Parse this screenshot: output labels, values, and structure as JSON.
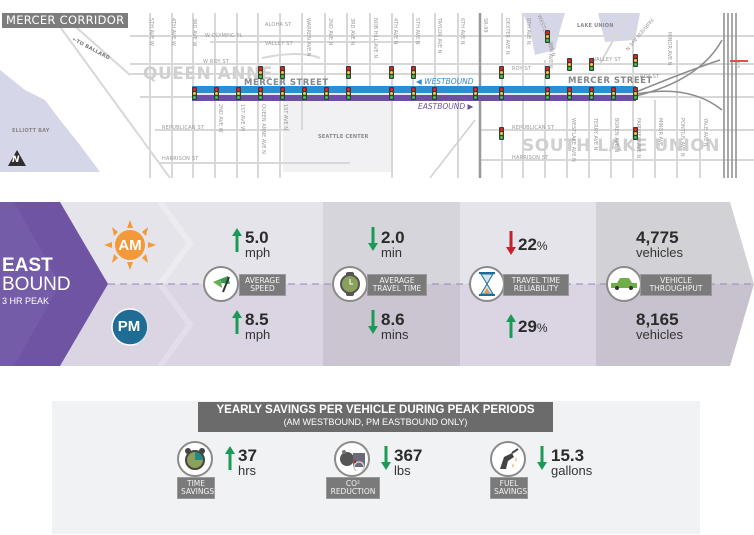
{
  "map": {
    "title": "MERCER CORRIDOR",
    "neighborhoods": [
      "QUEEN ANNE",
      "SOUTH LAKE UNION"
    ],
    "landmarks": {
      "elliott_bay": "ELLIOTT BAY",
      "seattle_center": "SEATTLE CENTER",
      "lake_union": "LAKE UNION",
      "to_ballard": "←TO BALLARD"
    },
    "corridor_label": "MERCER STREET",
    "corridor_label_east": "MERCER STREET",
    "westbound_label": "◀ WESTBOUND",
    "eastbound_label": "EASTBOUND ▶",
    "north_icon": "N",
    "streets_horizontal": [
      "ALOHA ST",
      "W OLYMPIC PL",
      "VALLEY ST",
      "W ROY ST",
      "REPUBLICAN ST",
      "HARRISON ST",
      "ROY ST",
      "REPUBLICAN ST",
      "HARRISON ST",
      "VALLEY ST",
      "ROY ST"
    ],
    "streets_vertical": [
      "5TH AVE W",
      "4TH AVE W",
      "3RD AVE W",
      "WARREN AVE N",
      "2ND AVE N",
      "3RD AVE N",
      "NOB HILL AVE N",
      "4TH AVE N",
      "5TH AVE N",
      "TAYLOR AVE N",
      "6TH AVE N",
      "SR-99",
      "DEXTER AVE N",
      "8TH AVE N",
      "9TH AVE N",
      "WESTLAKE AVE N",
      "FAIRVIEW AVE N",
      "MINOR AVE N",
      "2ND AVE W",
      "1ST AVE W",
      "QUEEN ANNE AVE N",
      "1ST AVE N",
      "WESTLAKE AVE N",
      "TERRY AVE N",
      "BOREN AVE N",
      "FAIRVIEW AVE N",
      "MINOR AVE",
      "PONTIUS AVE N",
      "YALE AVE N",
      "I-5"
    ],
    "colors": {
      "westbound": "#2a8fd0",
      "eastbound": "#6d4fa0",
      "water": "#d5d5e8"
    }
  },
  "eastbound": {
    "title_line1": "EAST",
    "title_line2": "BOUND",
    "subtitle": "3 HR PEAK",
    "am_label": "AM",
    "pm_label": "PM",
    "metrics": [
      {
        "name": "average-speed",
        "label_line1": "AVERAGE",
        "label_line2": "SPEED",
        "am": {
          "direction": "up",
          "value": "5.0",
          "unit": "mph"
        },
        "pm": {
          "direction": "up",
          "value": "8.5",
          "unit": "mph"
        }
      },
      {
        "name": "average-travel-time",
        "label_line1": "AVERAGE",
        "label_line2": "TRAVEL TIME",
        "am": {
          "direction": "down",
          "value": "2.0",
          "unit": "min"
        },
        "pm": {
          "direction": "down",
          "value": "8.6",
          "unit": "mins"
        }
      },
      {
        "name": "travel-time-reliability",
        "label_line1": "TRAVEL TIME",
        "label_line2": "RELIABILITY",
        "am": {
          "direction": "down",
          "value": "22",
          "unit": "%"
        },
        "pm": {
          "direction": "up",
          "value": "29",
          "unit": "%"
        }
      },
      {
        "name": "vehicle-throughput",
        "label_line1": "VEHICLE",
        "label_line2": "THROUGHPUT",
        "am": {
          "direction": "none",
          "value": "4,775",
          "unit": "vehicles"
        },
        "pm": {
          "direction": "none",
          "value": "8,165",
          "unit": "vehicles"
        }
      }
    ],
    "colors": {
      "up": "#1a9b55",
      "down_good": "#1a9b55",
      "down_bad": "#c8202e",
      "purple": "#6f54a3",
      "am_sun": "#f29a3a",
      "pm_moon": "#1f6c95"
    }
  },
  "savings": {
    "title": "YEARLY SAVINGS PER VEHICLE DURING PEAK PERIODS",
    "subtitle": "(AM WESTBOUND, PM EASTBOUND ONLY)",
    "items": [
      {
        "label_line1": "TIME",
        "label_line2": "SAVINGS",
        "direction": "up",
        "value": "37",
        "unit": "hrs"
      },
      {
        "label_line1": "CO²",
        "label_line2": "REDUCTION",
        "direction": "down",
        "value": "367",
        "unit": "lbs"
      },
      {
        "label_line1": "FUEL",
        "label_line2": "SAVINGS",
        "direction": "down",
        "value": "15.3",
        "unit": "gallons"
      }
    ]
  }
}
